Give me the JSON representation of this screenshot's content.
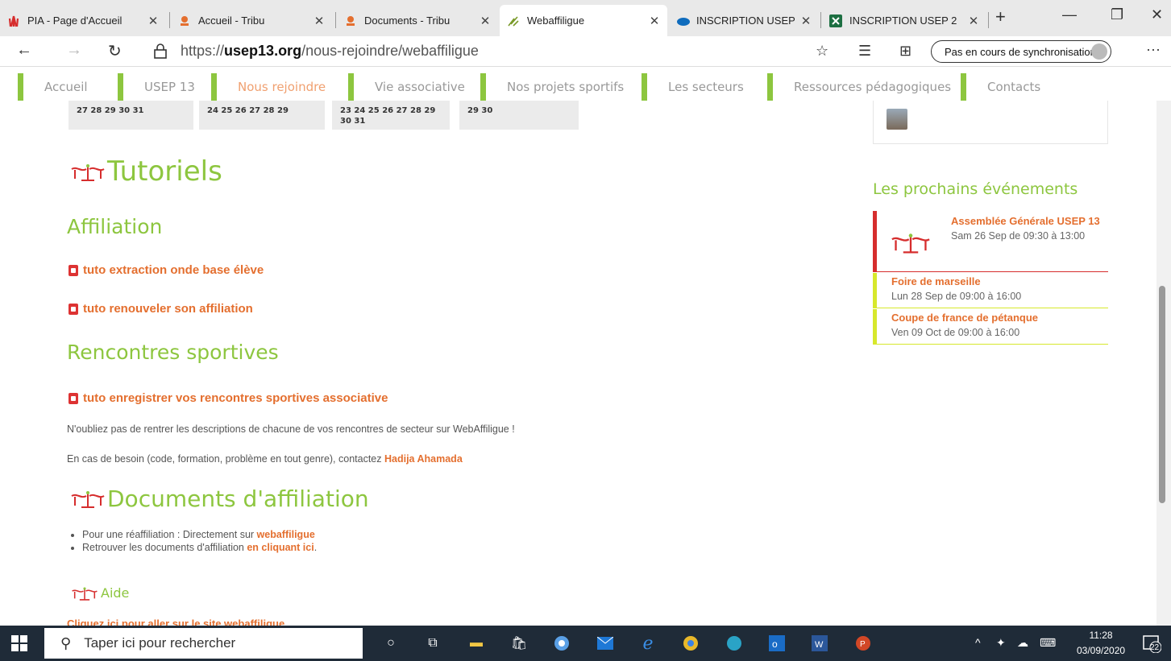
{
  "browser": {
    "tabs": [
      {
        "title": "PIA - Page d'Accueil",
        "icon": "shell-logo-icon",
        "color": "#d62d2d"
      },
      {
        "title": "Accueil - Tribu",
        "icon": "tribu-icon",
        "color": "#e46f2f"
      },
      {
        "title": "Documents - Tribu",
        "icon": "tribu-icon",
        "color": "#e46f2f"
      },
      {
        "title": "Webaffiligue",
        "icon": "webaffiligue-icon",
        "color": "#7a9a2a",
        "active": true
      },
      {
        "title": "INSCRIPTION USEP -",
        "icon": "onedrive-icon",
        "color": "#0f6cbd"
      },
      {
        "title": "INSCRIPTION USEP 2",
        "icon": "excel-icon",
        "color": "#1d6f42"
      }
    ],
    "new_tab": "+",
    "url_prefix": "https://",
    "url_domain": "usep13.org",
    "url_path": "/nous-rejoindre/webaffiligue",
    "sync_label": "Pas en cours de synchronisation",
    "more": "···"
  },
  "site_nav": {
    "items": [
      "Accueil",
      "USEP 13",
      "Nous rejoindre",
      "Vie associative",
      "Nos projets sportifs",
      "Les secteurs",
      "Ressources pédagogiques",
      "Contacts"
    ],
    "active_index": 2,
    "accent": "#8dc63f"
  },
  "calendar": {
    "cells": [
      {
        "line1": "27 28 29 30 31",
        "line2": ""
      },
      {
        "line1": "24 25 26 27 28 29",
        "line2": ""
      },
      {
        "line1": "23 24 25 26 27 28 29",
        "line2": "30 31"
      },
      {
        "line1": "29 30",
        "line2": ""
      }
    ]
  },
  "main": {
    "tutoriels_title": "Tutoriels",
    "affiliation_title": "Affiliation",
    "link_extraction": "tuto extraction onde base élève",
    "link_renouveler": "tuto renouveler son affiliation",
    "rencontres_title": "Rencontres sportives",
    "link_rencontres": "tuto enregistrer vos rencontres sportives associative",
    "para1": "N'oubliez pas de rentrer les descriptions de chacune de vos rencontres de secteur sur WebAffiligue !",
    "para2_text": "En cas de besoin (code, formation, problème en tout genre), contactez ",
    "para2_link": "Hadija Ahamada",
    "documents_title": "Documents d'affiliation",
    "bullet1_text": "Pour une réaffiliation : Directement sur ",
    "bullet1_link": "webaffiligue",
    "bullet2_text": "Retrouver les documents d'affiliation ",
    "bullet2_link": "en cliquant ici",
    "bullet2_tail": ".",
    "aide_title": "Aide",
    "aide_link": "Cliquez ici pour aller sur le site webaffiligue"
  },
  "sidebar": {
    "events_title": "Les prochains événements",
    "events": [
      {
        "title": "Assemblée Générale USEP 13",
        "date": "Sam 26 Sep de 09:30 à 13:00",
        "accent": "#d62d2d"
      },
      {
        "title": "Foire de marseille",
        "date": "Lun 28 Sep de 09:00 à 16:00",
        "accent": "#d7e82c"
      },
      {
        "title": "Coupe de france de pétanque",
        "date": "Ven 09 Oct de 09:00 à 16:00",
        "accent": "#d7e82c"
      }
    ]
  },
  "taskbar": {
    "search_placeholder": "Taper ici pour rechercher",
    "time": "11:28",
    "date": "03/09/2020",
    "notifications": "22"
  }
}
